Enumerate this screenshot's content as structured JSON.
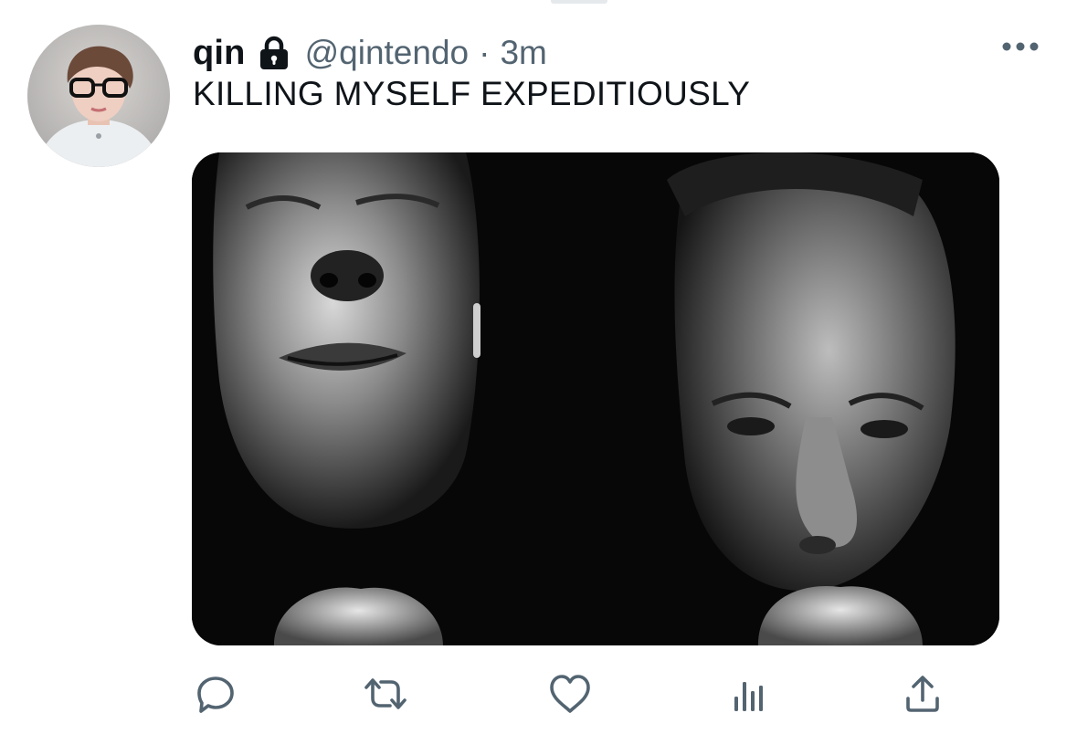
{
  "tweet": {
    "display_name": "qin",
    "protected_icon": "lock-icon",
    "handle": "@qintendo",
    "separator": "·",
    "time": "3m",
    "text": "KILLING MYSELF EXPEDITIOUSLY",
    "more_icon": "more-horizontal-icon",
    "media_description_icon": "photo"
  },
  "actions": {
    "reply_icon": "reply-icon",
    "retweet_icon": "retweet-icon",
    "like_icon": "heart-icon",
    "analytics_icon": "analytics-icon",
    "share_icon": "share-icon"
  },
  "colors": {
    "text_primary": "#0f1419",
    "text_secondary": "#536471",
    "icon": "#536471"
  }
}
